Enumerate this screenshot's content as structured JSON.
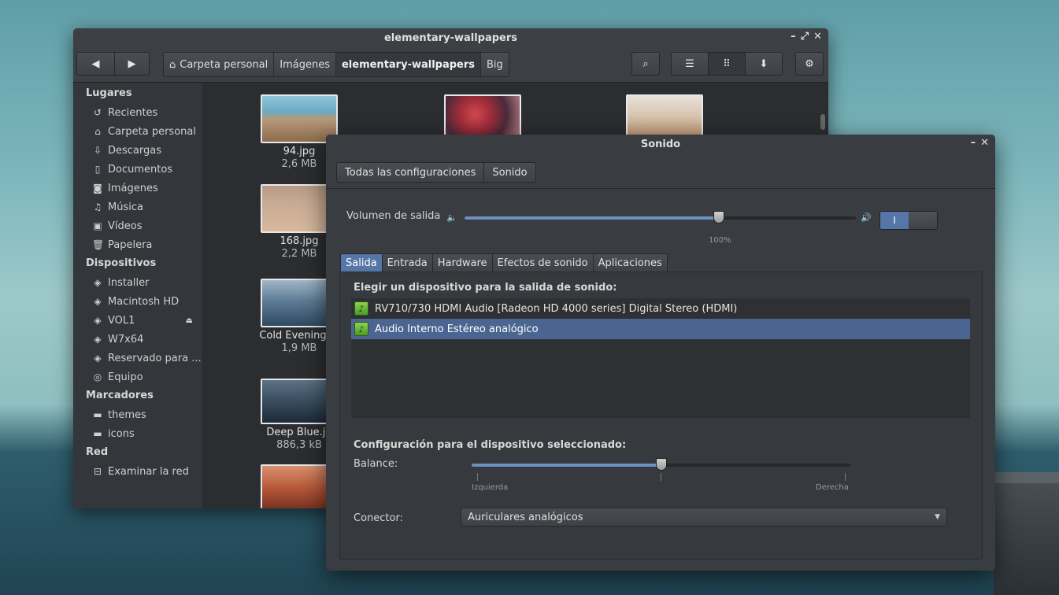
{
  "file_manager": {
    "title": "elementary-wallpapers",
    "breadcrumbs": [
      "Carpeta personal",
      "Imágenes",
      "elementary-wallpapers",
      "Big"
    ],
    "sidebar": {
      "sections": [
        {
          "header": "Lugares",
          "items": [
            {
              "label": "Recientes",
              "icon": "clock-icon"
            },
            {
              "label": "Carpeta personal",
              "icon": "home-icon"
            },
            {
              "label": "Descargas",
              "icon": "download-icon"
            },
            {
              "label": "Documentos",
              "icon": "document-icon"
            },
            {
              "label": "Imágenes",
              "icon": "camera-icon"
            },
            {
              "label": "Música",
              "icon": "music-icon"
            },
            {
              "label": "Vídeos",
              "icon": "video-icon"
            },
            {
              "label": "Papelera",
              "icon": "trash-icon"
            }
          ]
        },
        {
          "header": "Dispositivos",
          "items": [
            {
              "label": "Installer",
              "icon": "drive-icon"
            },
            {
              "label": "Macintosh HD",
              "icon": "drive-icon"
            },
            {
              "label": "VOL1",
              "icon": "drive-icon"
            },
            {
              "label": "W7x64",
              "icon": "drive-icon"
            },
            {
              "label": "Reservado para ...",
              "icon": "drive-icon"
            },
            {
              "label": "Equipo",
              "icon": "computer-icon"
            }
          ]
        },
        {
          "header": "Marcadores",
          "items": [
            {
              "label": "themes",
              "icon": "folder-icon"
            },
            {
              "label": "icons",
              "icon": "folder-icon"
            }
          ]
        },
        {
          "header": "Red",
          "items": [
            {
              "label": "Examinar la red",
              "icon": "network-icon"
            }
          ]
        }
      ]
    },
    "files": [
      {
        "name": "94.jpg",
        "size": "2,6 MB"
      },
      {
        "name": "",
        "size": ""
      },
      {
        "name": "",
        "size": ""
      },
      {
        "name": "168.jpg",
        "size": "2,2 MB"
      },
      {
        "name": "Cold Evening.jp",
        "size": "1,9 MB"
      },
      {
        "name": "Deep Blue.jp",
        "size": "886,3 kB"
      },
      {
        "name": "",
        "size": ""
      }
    ]
  },
  "sound": {
    "title": "Sonido",
    "breadcrumbs": [
      "Todas las configuraciones",
      "Sonido"
    ],
    "output_volume_label": "Volumen de salida",
    "volume_value": 0.65,
    "volume_mark": "100%",
    "mute_switch_label": "I",
    "tabs": [
      "Salida",
      "Entrada",
      "Hardware",
      "Efectos de sonido",
      "Aplicaciones"
    ],
    "active_tab": "Salida",
    "choose_device_heading": "Elegir un dispositivo para la salida de sonido:",
    "devices": [
      {
        "label": "RV710/730 HDMI Audio [Radeon HD 4000 series] Digital Stereo (HDMI)",
        "selected": false
      },
      {
        "label": "Audio Interno Estéreo analógico",
        "selected": true
      }
    ],
    "device_config_heading": "Configuración para el dispositivo seleccionado:",
    "balance_label": "Balance:",
    "balance_value": 0.5,
    "balance_left": "Izquierda",
    "balance_right": "Derecha",
    "connector_label": "Conector:",
    "connector_value": "Auriculares analógicos"
  },
  "colors": {
    "accent": "#5576a6",
    "selection": "#4b6591"
  }
}
